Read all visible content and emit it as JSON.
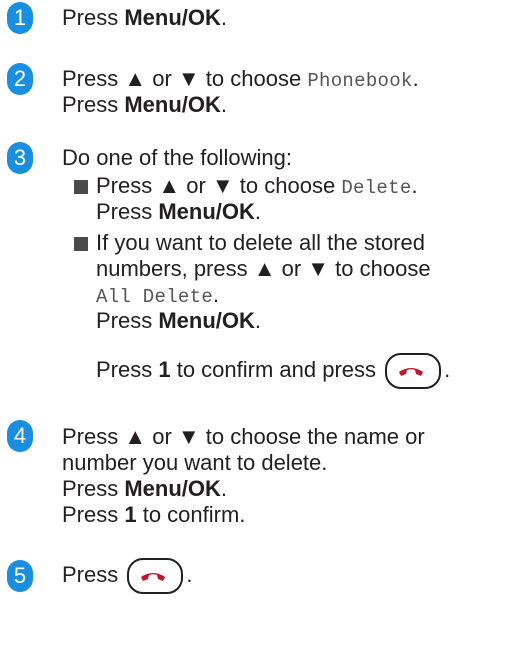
{
  "steps": [
    {
      "num": "1",
      "lines": {
        "l1_a": "Press ",
        "l1_b": "Menu/OK",
        "l1_c": "."
      }
    },
    {
      "num": "2",
      "lines": {
        "l1_a": "Press ▲ or ▼ to choose ",
        "l1_mono": "Phonebook",
        "l1_c": ".",
        "l2_a": "Press ",
        "l2_b": "Menu/OK",
        "l2_c": "."
      }
    },
    {
      "num": "3",
      "intro": "Do one of the following:",
      "bullet1": {
        "a": "Press ▲ or ▼ to choose ",
        "mono": "Delete",
        "c": ".",
        "l2_a": "Press ",
        "l2_b": "Menu/OK",
        "l2_c": "."
      },
      "bullet2": {
        "l1": "If you want to delete all the stored",
        "l2": "numbers, press ▲ or ▼ to choose",
        "mono": "All Delete",
        "mono_c": ".",
        "l4_a": "Press ",
        "l4_b": "Menu/OK",
        "l4_c": "."
      },
      "confirm": {
        "a": "Press ",
        "b": "1",
        "c": " to confirm and press ",
        "d": "."
      }
    },
    {
      "num": "4",
      "lines": {
        "l1": "Press ▲ or ▼ to choose the name or",
        "l2": "number you want to delete.",
        "l3_a": "Press ",
        "l3_b": "Menu/OK",
        "l3_c": ".",
        "l4_a": "Press ",
        "l4_b": "1",
        "l4_c": " to confirm."
      }
    },
    {
      "num": "5",
      "lines": {
        "l1_a": "Press ",
        "l1_c": "."
      }
    }
  ],
  "icons": {
    "end_key": "end-call-key-icon",
    "bullet": "square-bullet-icon"
  },
  "colors": {
    "badge": "#1a8fe0",
    "end_key_handset": "#c0152f"
  }
}
